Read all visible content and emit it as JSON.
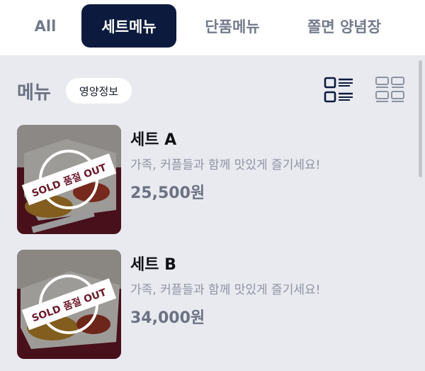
{
  "tabs": [
    {
      "label": "All"
    },
    {
      "label": "세트메뉴"
    },
    {
      "label": "단품메뉴"
    },
    {
      "label": "쫄면 양념장"
    }
  ],
  "active_tab": "세트메뉴",
  "section": {
    "title": "메뉴",
    "nutrition_button": "영양정보"
  },
  "view_modes": [
    {
      "icon": "list-view-icon",
      "selected": true
    },
    {
      "icon": "grid-view-icon",
      "selected": false
    }
  ],
  "items": [
    {
      "name": "세트 A",
      "description": "가족, 커플들과 함께 맛있게 즐기세요!",
      "price": "25,500원",
      "badge": "SOLD 품절 OUT"
    },
    {
      "name": "세트 B",
      "description": "가족, 커플들과 함께 맛있게 즐기세요!",
      "price": "34,000원",
      "badge": "SOLD 품절 OUT"
    }
  ],
  "colors": {
    "active_tab_bg": "#0c1b3d",
    "page_bg": "#e9eaf0",
    "muted_text": "#6b7283"
  }
}
